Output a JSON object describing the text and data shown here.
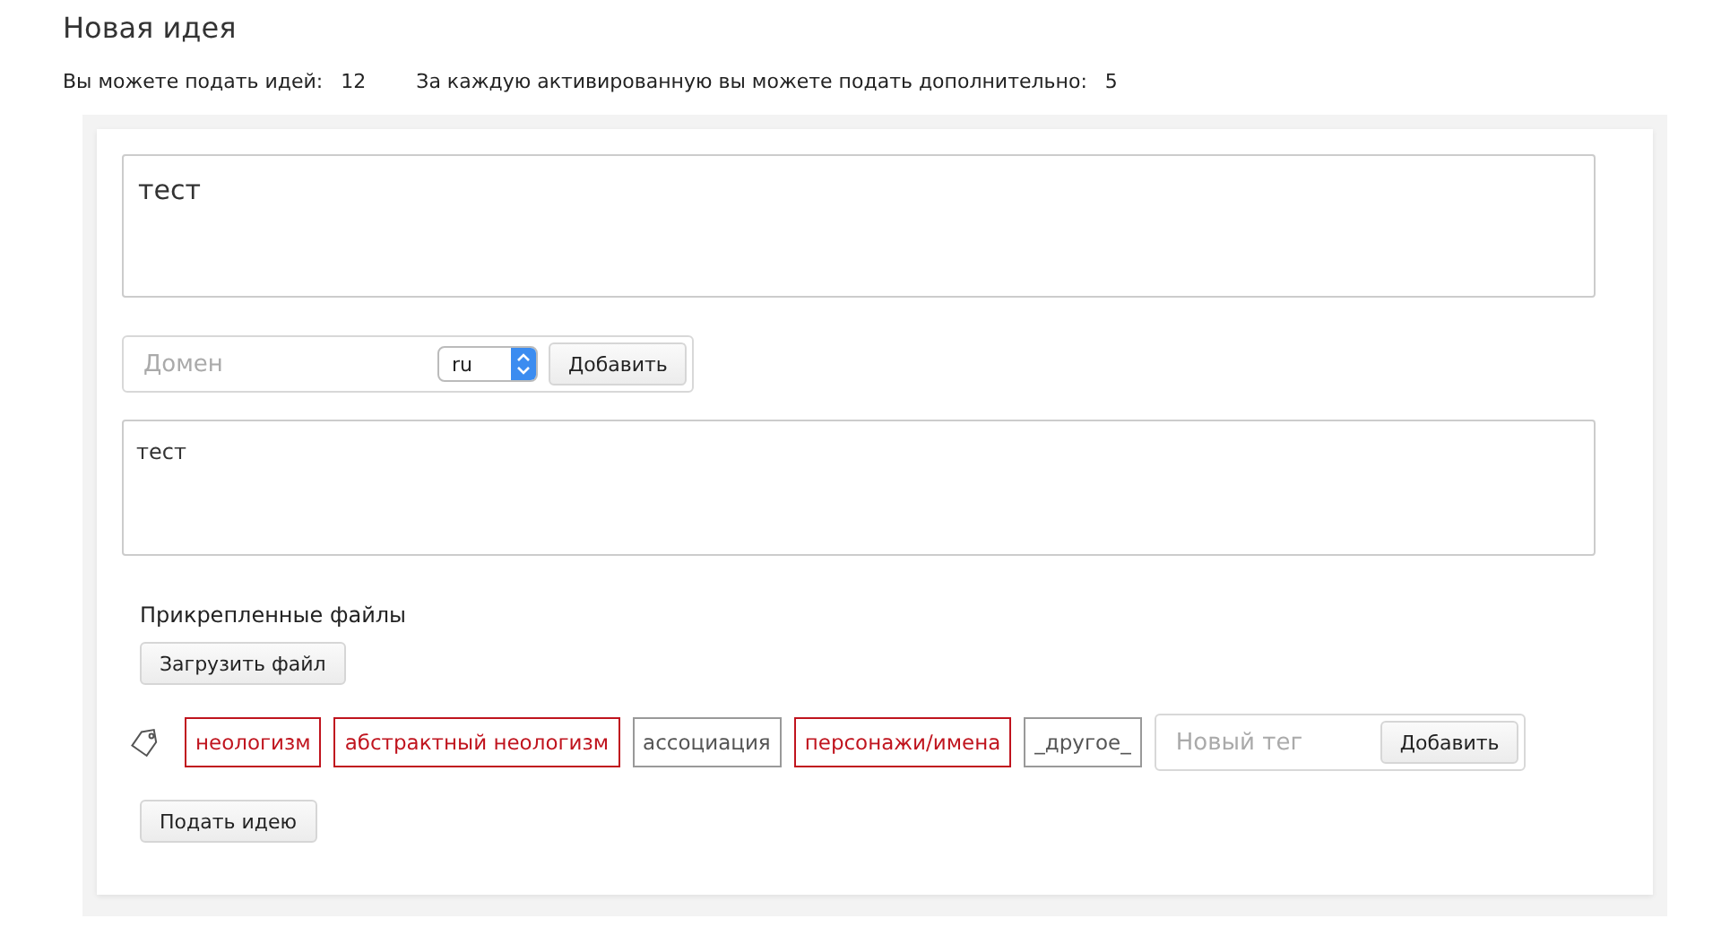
{
  "page_title": "Новая идея",
  "stats": [
    {
      "label": "Вы можете подать идей:",
      "value": "12"
    },
    {
      "label": "За каждую активированную вы можете подать дополнительно:",
      "value": "5"
    }
  ],
  "title_field": {
    "value": "тест"
  },
  "domain": {
    "placeholder": "Домен",
    "zone": "ru",
    "button": "Добавить"
  },
  "description_field": {
    "value": "тест"
  },
  "attachments": {
    "label": "Прикрепленные файлы",
    "button": "Загрузить файл"
  },
  "tags": [
    {
      "label": "неологизм",
      "selected": true
    },
    {
      "label": "абстрактный неологизм",
      "selected": true
    },
    {
      "label": "ассоциация",
      "selected": false
    },
    {
      "label": "персонажи/имена",
      "selected": true
    },
    {
      "label": "_другое_",
      "selected": false
    }
  ],
  "new_tag": {
    "placeholder": "Новый тег",
    "button": "Добавить"
  },
  "submit_button": "Подать идею"
}
